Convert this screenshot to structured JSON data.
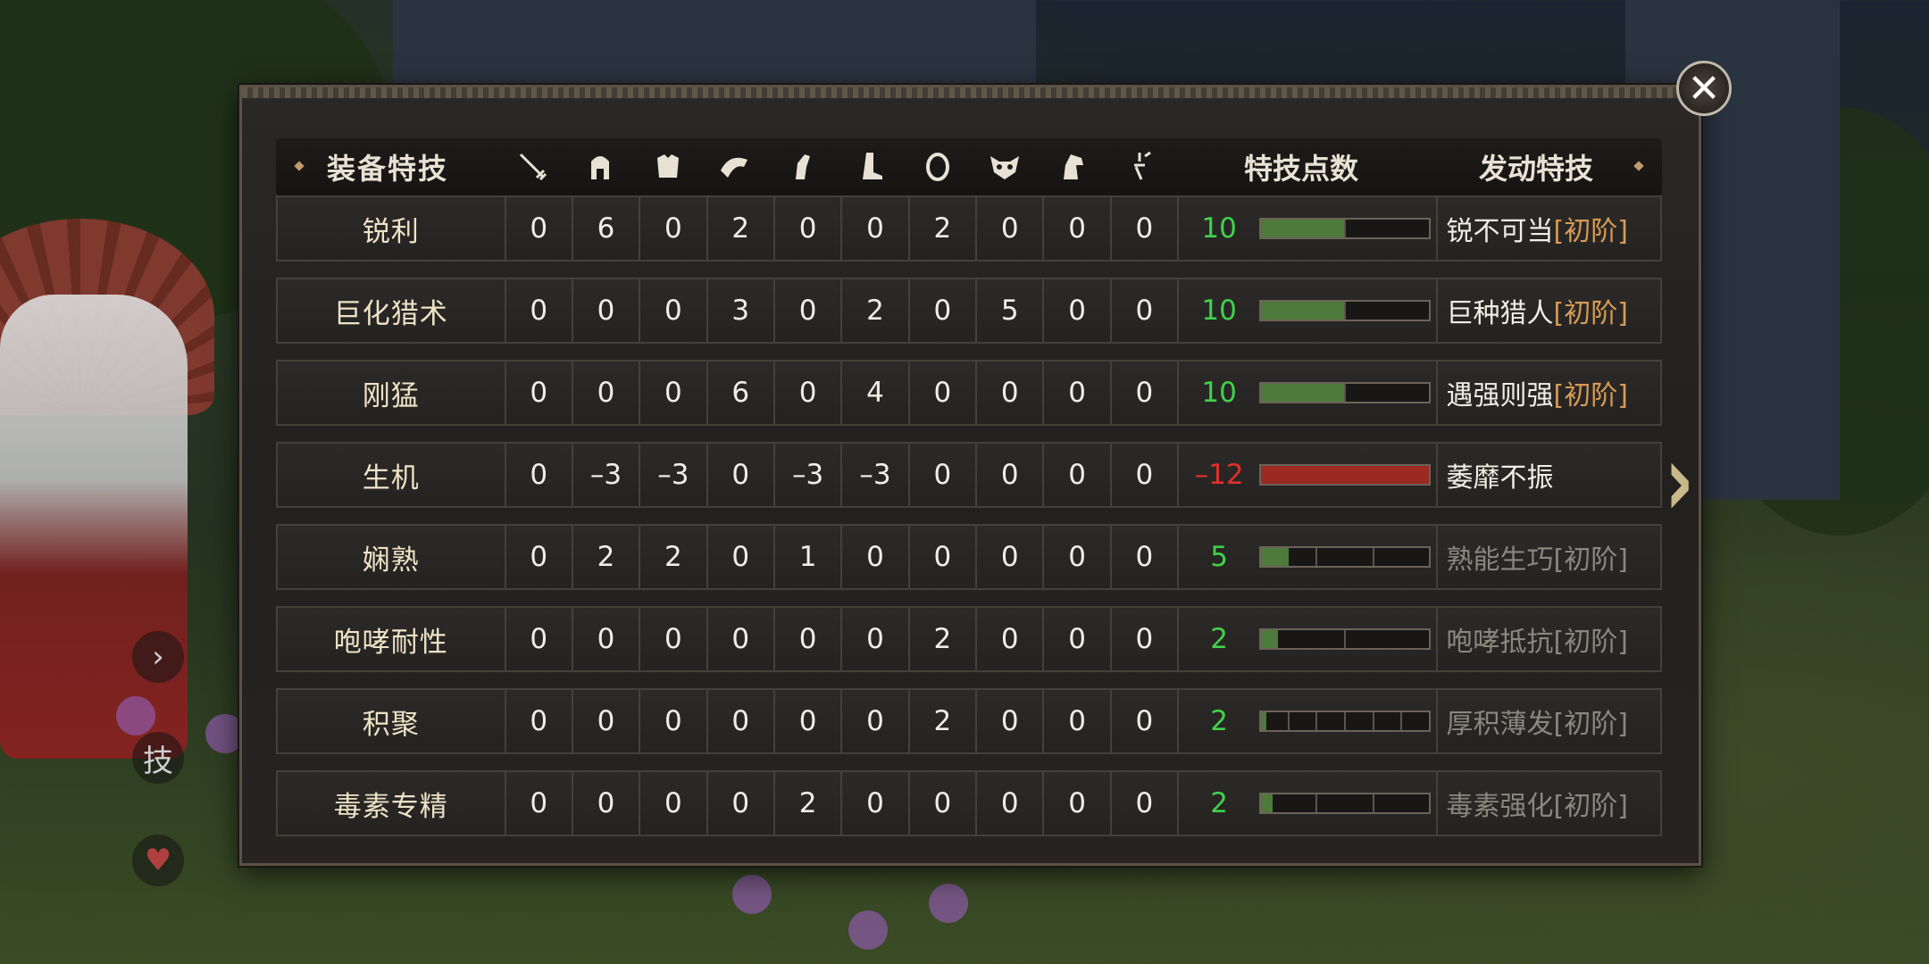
{
  "panel": {
    "header": {
      "title": "装备特技",
      "slots": [
        "sword-icon",
        "helmet-icon",
        "chest-armor-icon",
        "shoulder-armor-icon",
        "gauntlet-icon",
        "boot-icon",
        "charm-icon",
        "mask-icon",
        "horse-icon",
        "trinket-icon"
      ],
      "points_label": "特技点数",
      "skill_label": "发动特技"
    },
    "rows": [
      {
        "name": "锐利",
        "values": [
          "0",
          "6",
          "0",
          "2",
          "0",
          "0",
          "2",
          "0",
          "0",
          "0"
        ],
        "points": "10",
        "fill": 0.5,
        "segments": 2,
        "status": "positive",
        "skill": "锐不可当",
        "tier": "[初阶]",
        "active": true
      },
      {
        "name": "巨化猎术",
        "values": [
          "0",
          "0",
          "0",
          "3",
          "0",
          "2",
          "0",
          "5",
          "0",
          "0"
        ],
        "points": "10",
        "fill": 0.5,
        "segments": 2,
        "status": "positive",
        "skill": "巨种猎人",
        "tier": "[初阶]",
        "active": true
      },
      {
        "name": "刚猛",
        "values": [
          "0",
          "0",
          "0",
          "6",
          "0",
          "4",
          "0",
          "0",
          "0",
          "0"
        ],
        "points": "10",
        "fill": 0.5,
        "segments": 2,
        "status": "positive",
        "skill": "遇强则强",
        "tier": "[初阶]",
        "active": true
      },
      {
        "name": "生机",
        "values": [
          "0",
          "–3",
          "–3",
          "0",
          "–3",
          "–3",
          "0",
          "0",
          "0",
          "0"
        ],
        "points": "–12",
        "fill": 1.0,
        "segments": 1,
        "status": "negative",
        "skill": "萎靡不振",
        "tier": "",
        "active": true
      },
      {
        "name": "娴熟",
        "values": [
          "0",
          "2",
          "2",
          "0",
          "1",
          "0",
          "0",
          "0",
          "0",
          "0"
        ],
        "points": "5",
        "fill": 0.167,
        "segments": 3,
        "status": "positive",
        "skill": "熟能生巧",
        "tier": "[初阶]",
        "active": false
      },
      {
        "name": "咆哮耐性",
        "values": [
          "0",
          "0",
          "0",
          "0",
          "0",
          "0",
          "2",
          "0",
          "0",
          "0"
        ],
        "points": "2",
        "fill": 0.1,
        "segments": 2,
        "status": "positive",
        "skill": "咆哮抵抗",
        "tier": "[初阶]",
        "active": false
      },
      {
        "name": "积聚",
        "values": [
          "0",
          "0",
          "0",
          "0",
          "0",
          "0",
          "2",
          "0",
          "0",
          "0"
        ],
        "points": "2",
        "fill": 0.033,
        "segments": 6,
        "status": "positive",
        "skill": "厚积薄发",
        "tier": "[初阶]",
        "active": false
      },
      {
        "name": "毒素专精",
        "values": [
          "0",
          "0",
          "0",
          "0",
          "2",
          "0",
          "0",
          "0",
          "0",
          "0"
        ],
        "points": "2",
        "fill": 0.067,
        "segments": 3,
        "status": "positive",
        "skill": "毒素强化",
        "tier": "[初阶]",
        "active": false
      }
    ]
  },
  "colors": {
    "positive": "#3fd24a",
    "negative": "#e0302a",
    "bar_positive": "#4e7a3c",
    "bar_negative": "#9b2a22",
    "tier": "#d79a56"
  },
  "side_buttons": {
    "skill_label": "技"
  }
}
